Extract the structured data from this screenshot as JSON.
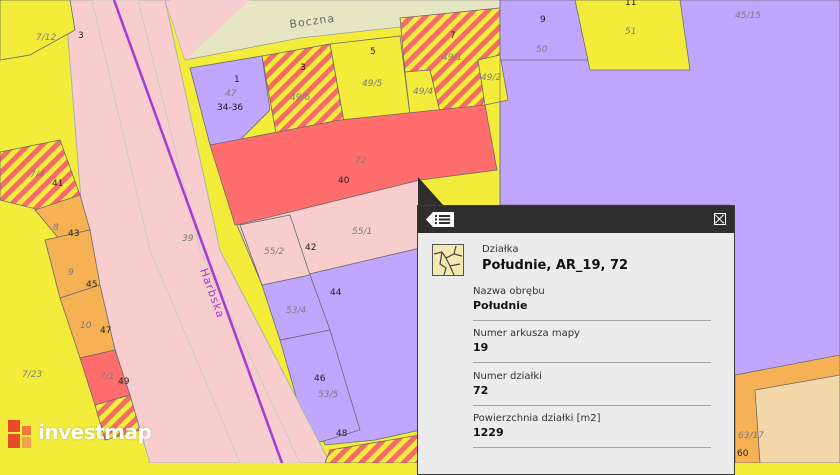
{
  "map": {
    "street_labels": [
      "Boczna",
      "Harbska"
    ],
    "parcel_labels": [
      "7/12",
      "3",
      "7",
      "11",
      "45/15",
      "9",
      "51",
      "50",
      "1",
      "47",
      "3",
      "49/6",
      "5",
      "49/5",
      "49/1",
      "49/4",
      "49/2",
      "34-36",
      "72",
      "40",
      "7/4",
      "41",
      "8",
      "43",
      "39",
      "9",
      "45",
      "10",
      "47",
      "7/23",
      "7/1",
      "49",
      "55/1",
      "55/2",
      "42",
      "53/4",
      "44",
      "46",
      "53/5",
      "48",
      "63/17",
      "60"
    ]
  },
  "popup": {
    "kind": "Działka",
    "title": "Południe, AR_19, 72",
    "fields": [
      {
        "label": "Nazwa obrębu",
        "value": "Południe"
      },
      {
        "label": "Numer arkusza mapy",
        "value": "19"
      },
      {
        "label": "Numer działki",
        "value": "72"
      },
      {
        "label": "Powierzchnia działki [m2]",
        "value": "1229"
      }
    ],
    "icons": [
      "list-icon",
      "close-icon",
      "parcel-icon"
    ]
  },
  "brand": {
    "name": "investmap"
  },
  "colors": {
    "residential": "#f3ec3a",
    "service": "#c1a6ff",
    "selected": "#ff6d6d",
    "road": "#f7cdcd",
    "road_edge": "#c9c9c9",
    "street_line": "#a43ad8",
    "orange": "#f7b155",
    "green_strip": "#e6e6c3",
    "hatch_red": "#f56a6a"
  }
}
